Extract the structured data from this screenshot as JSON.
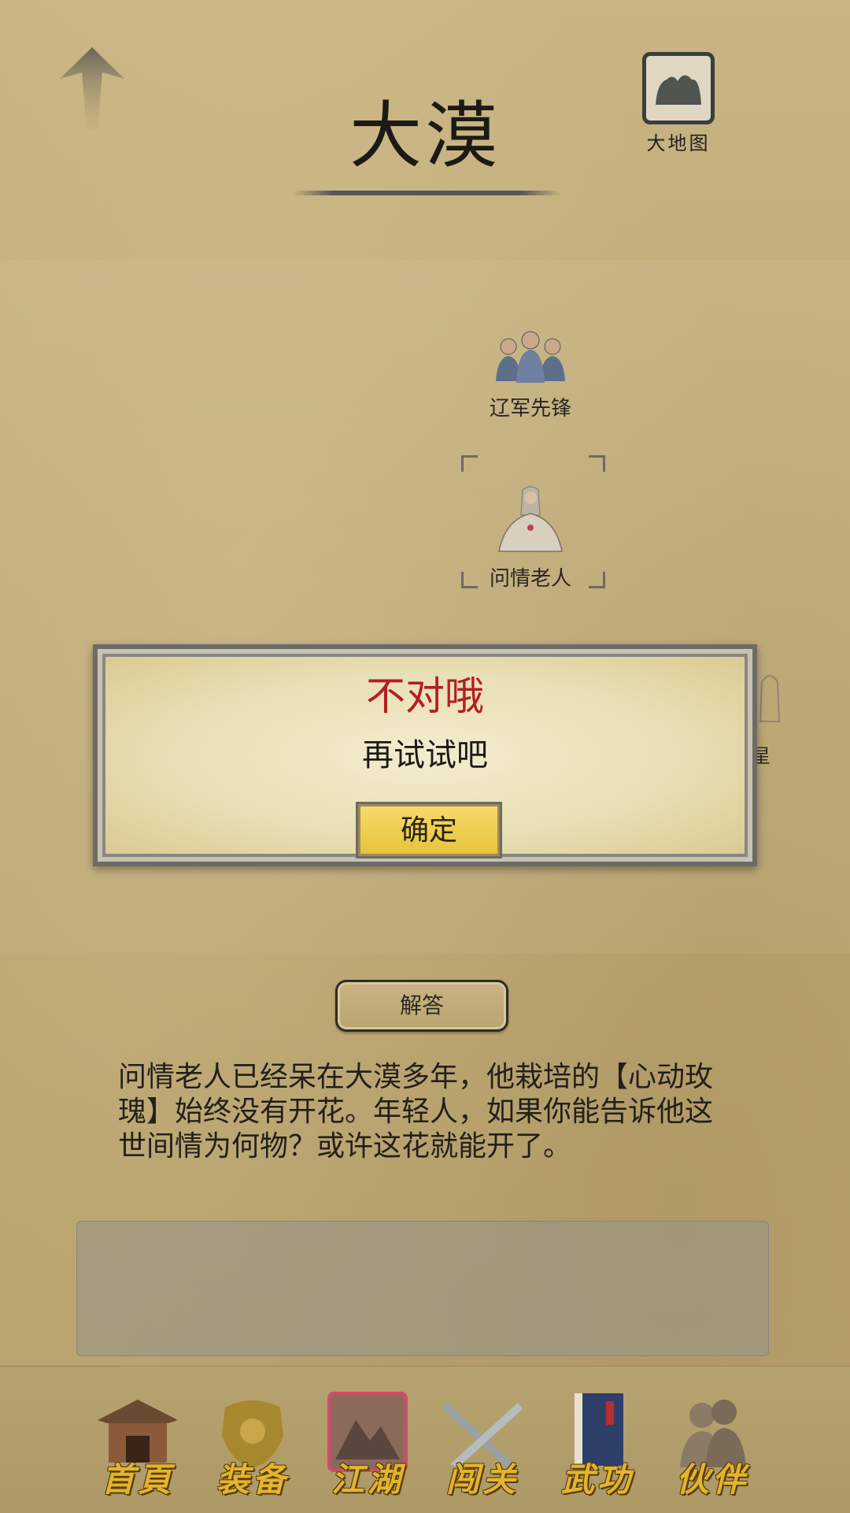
{
  "header": {
    "title": "大漠",
    "map_button_label": "大地图"
  },
  "scene": {
    "npcs": [
      {
        "label": "辽军先锋",
        "icon": "soldiers-icon"
      },
      {
        "label": "问情老人",
        "icon": "old-man-icon"
      }
    ],
    "partial_label": "星"
  },
  "answer_button_label": "解答",
  "description": "问情老人已经呆在大漠多年，他栽培的【心动玫瑰】始终没有开花。年轻人，如果你能告诉他这世间情为何物？或许这花就能开了。",
  "input": {
    "value": "",
    "placeholder": ""
  },
  "tabs": [
    {
      "label": "首頁",
      "icon": "home-pavilion-icon"
    },
    {
      "label": "装备",
      "icon": "armor-icon"
    },
    {
      "label": "江湖",
      "icon": "map-scroll-icon",
      "active": true
    },
    {
      "label": "闯关",
      "icon": "crossed-swords-icon"
    },
    {
      "label": "武功",
      "icon": "martial-book-icon"
    },
    {
      "label": "伙伴",
      "icon": "partners-icon"
    }
  ],
  "dialog": {
    "title": "不对哦",
    "message": "再试试吧",
    "confirm_label": "确定"
  },
  "colors": {
    "dialog_title": "#b22020",
    "tab_label": "#e2b52c",
    "confirm_button": "#e7c23a"
  }
}
